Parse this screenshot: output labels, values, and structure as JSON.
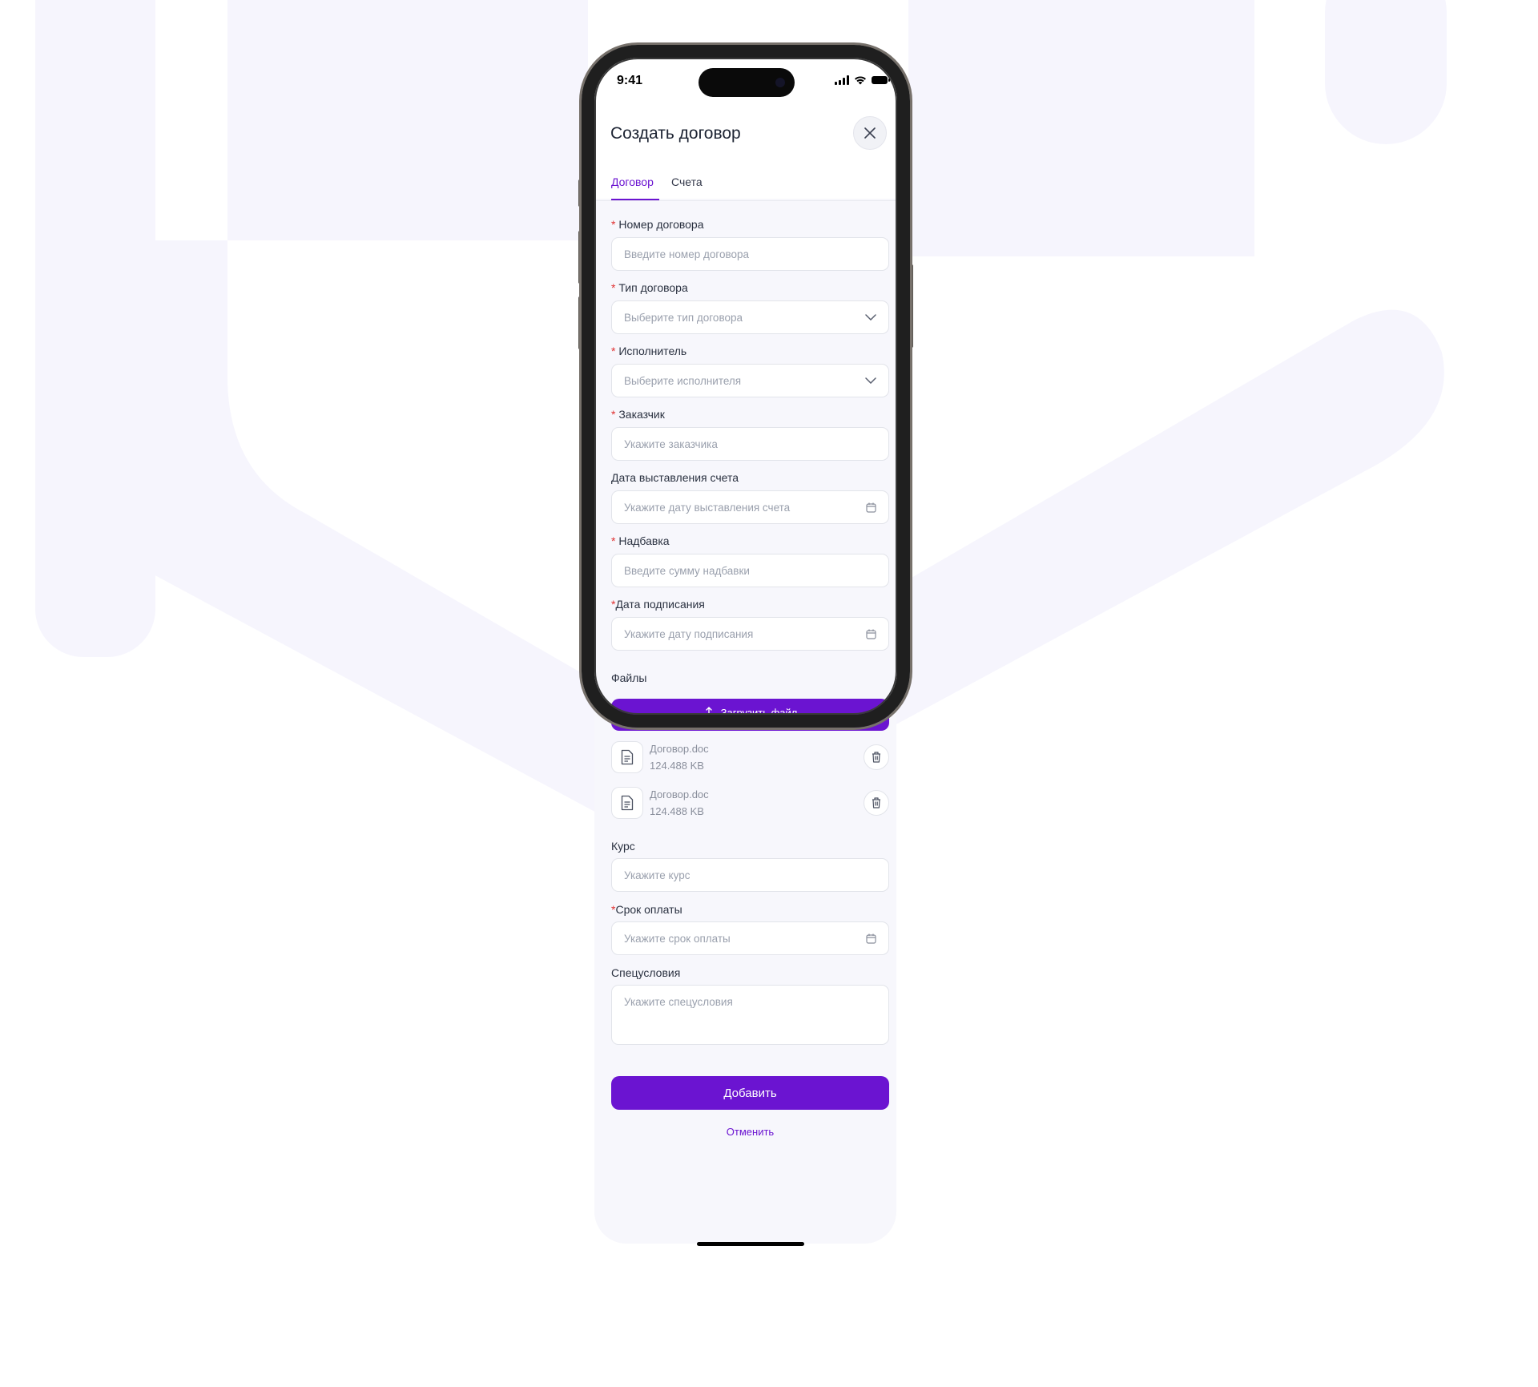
{
  "status_bar": {
    "time": "9:41"
  },
  "header": {
    "title": "Создать договор",
    "tabs": [
      {
        "label": "Договор",
        "active": true
      },
      {
        "label": "Счета",
        "active": false
      }
    ]
  },
  "form": {
    "contract_number": {
      "required_mark": "*",
      "label": "Номер договора",
      "placeholder": "Введите номер договора"
    },
    "contract_type": {
      "required_mark": "*",
      "label": "Тип договора",
      "placeholder": "Выберите тип договора"
    },
    "executor": {
      "required_mark": "*",
      "label": "Исполнитель",
      "placeholder": "Выберите исполнителя"
    },
    "customer": {
      "required_mark": "*",
      "label": "Заказчик",
      "placeholder": "Укажите заказчика"
    },
    "invoice_date": {
      "label": "Дата выставления счета",
      "placeholder": "Укажите дату выставления счета"
    },
    "markup": {
      "required_mark": "*",
      "label": "Надбавка",
      "placeholder": "Введите сумму надбавки"
    },
    "signing_date": {
      "required_mark": "*",
      "label": "Дата подписания",
      "placeholder": "Укажите дату подписания"
    },
    "files": {
      "label": "Файлы",
      "upload_label": "Загрузить файл",
      "items": [
        {
          "name": "Договор.doc",
          "size": "124.488 KB"
        },
        {
          "name": "Договор.doc",
          "size": "124.488 KB"
        }
      ]
    },
    "rate": {
      "label": "Курс",
      "placeholder": "Укажите курс"
    },
    "payment_term": {
      "required_mark": "*",
      "label": "Срок оплаты",
      "placeholder": "Укажите срок оплаты"
    },
    "special_terms": {
      "label": "Спецусловия",
      "placeholder": "Укажите спецусловия"
    }
  },
  "actions": {
    "submit_label": "Добавить",
    "cancel_label": "Отменить"
  },
  "colors": {
    "accent": "#6b14d1",
    "required": "#e03131",
    "background_shape": "#f6f5fd"
  }
}
